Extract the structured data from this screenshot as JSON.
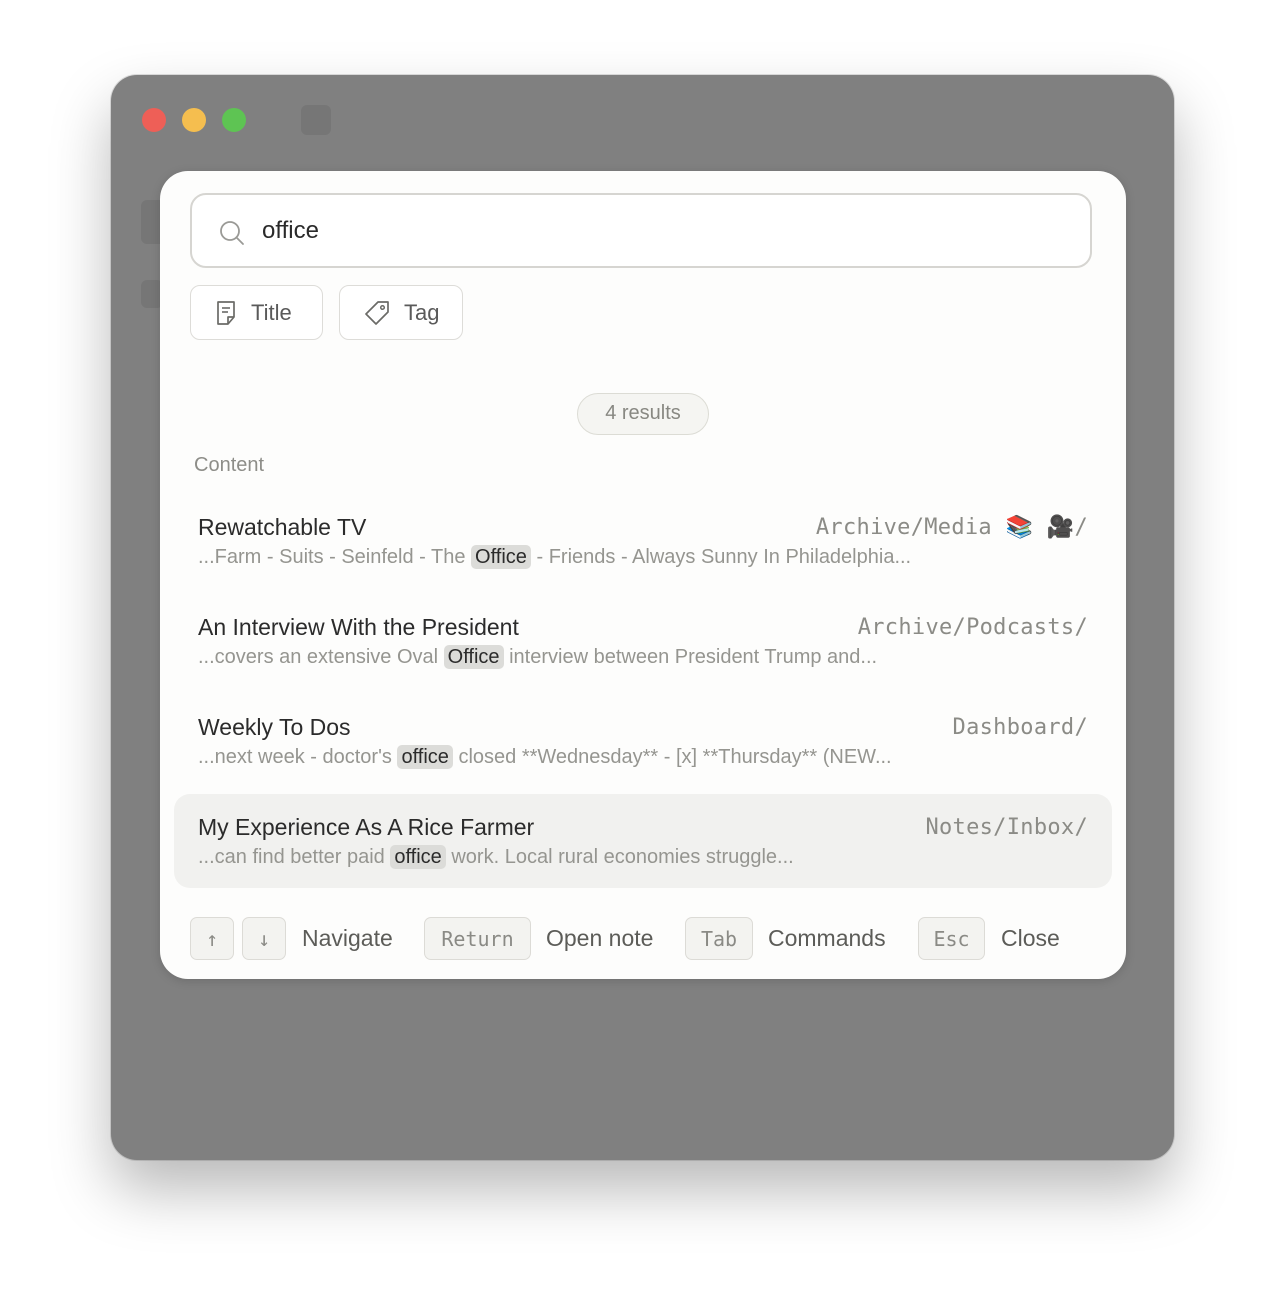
{
  "search": {
    "value": "office"
  },
  "filters": [
    {
      "label": "Title",
      "icon": "note-icon"
    },
    {
      "label": "Tag",
      "icon": "tag-icon"
    }
  ],
  "results_count": "4 results",
  "section_label": "Content",
  "results": [
    {
      "title": "Rewatchable TV",
      "path": "Archive/Media 📚 🎥/",
      "snippet_before": "...Farm - Suits - Seinfeld - The ",
      "snippet_match": "Office",
      "snippet_after": " - Friends - Always Sunny In Philadelphia..."
    },
    {
      "title": "An Interview With the President",
      "path": "Archive/Podcasts/",
      "snippet_before": "...covers an extensive Oval ",
      "snippet_match": "Office",
      "snippet_after": " interview between President Trump and..."
    },
    {
      "title": "Weekly To Dos",
      "path": "Dashboard/",
      "snippet_before": "...next week - doctor's ",
      "snippet_match": "office",
      "snippet_after": " closed **Wednesday** - [x] **Thursday** (NEW..."
    },
    {
      "title": "My Experience As A Rice Farmer",
      "path": "Notes/Inbox/",
      "snippet_before": "...can find better paid ",
      "snippet_match": "office",
      "snippet_after": " work. Local rural economies struggle..."
    }
  ],
  "footer": {
    "up_key": "↑",
    "down_key": "↓",
    "navigate": "Navigate",
    "return_key": "Return",
    "open_note": "Open note",
    "tab_key": "Tab",
    "commands": "Commands",
    "esc_key": "Esc",
    "close": "Close"
  }
}
